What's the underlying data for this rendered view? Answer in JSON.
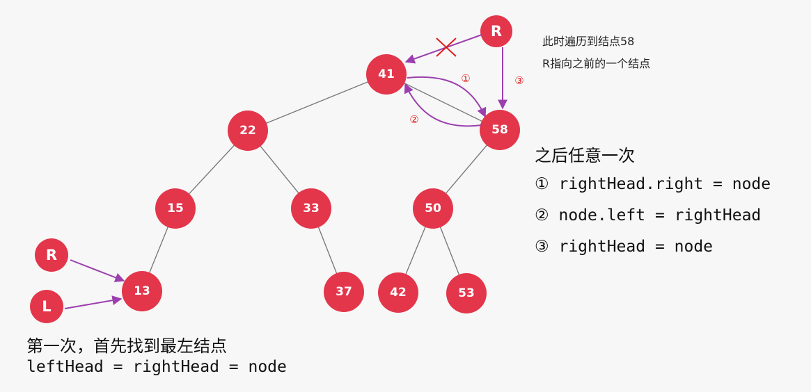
{
  "tree": {
    "nodes": [
      {
        "id": "n41",
        "label": "41"
      },
      {
        "id": "n22",
        "label": "22"
      },
      {
        "id": "n58",
        "label": "58"
      },
      {
        "id": "n15",
        "label": "15"
      },
      {
        "id": "n33",
        "label": "33"
      },
      {
        "id": "n50",
        "label": "50"
      },
      {
        "id": "n13",
        "label": "13"
      },
      {
        "id": "n37",
        "label": "37"
      },
      {
        "id": "n42",
        "label": "42"
      },
      {
        "id": "n53",
        "label": "53"
      }
    ],
    "edges": [
      [
        "41",
        "22"
      ],
      [
        "41",
        "58"
      ],
      [
        "22",
        "15"
      ],
      [
        "22",
        "33"
      ],
      [
        "58",
        "50"
      ],
      [
        "15",
        "13"
      ],
      [
        "33",
        "37"
      ],
      [
        "50",
        "42"
      ],
      [
        "50",
        "53"
      ]
    ]
  },
  "pointers": {
    "r_top": "R",
    "r_left": "R",
    "l_left": "L"
  },
  "step_markers": {
    "one": "①",
    "two": "②",
    "three": "③"
  },
  "note": {
    "line1": "此时遍历到结点58",
    "line2": "R指向之前的一个结点"
  },
  "after": {
    "title": "之后任意一次",
    "steps": [
      "① rightHead.right = node",
      "② node.left = rightHead",
      "③ rightHead = node"
    ]
  },
  "first": {
    "title": "第一次，首先找到最左结点",
    "code": "leftHead = rightHead = node"
  },
  "colors": {
    "node": "#e3364b",
    "arrow": "#9b3fae",
    "cross": "#e01b1b",
    "edge": "#7a7a7a"
  }
}
